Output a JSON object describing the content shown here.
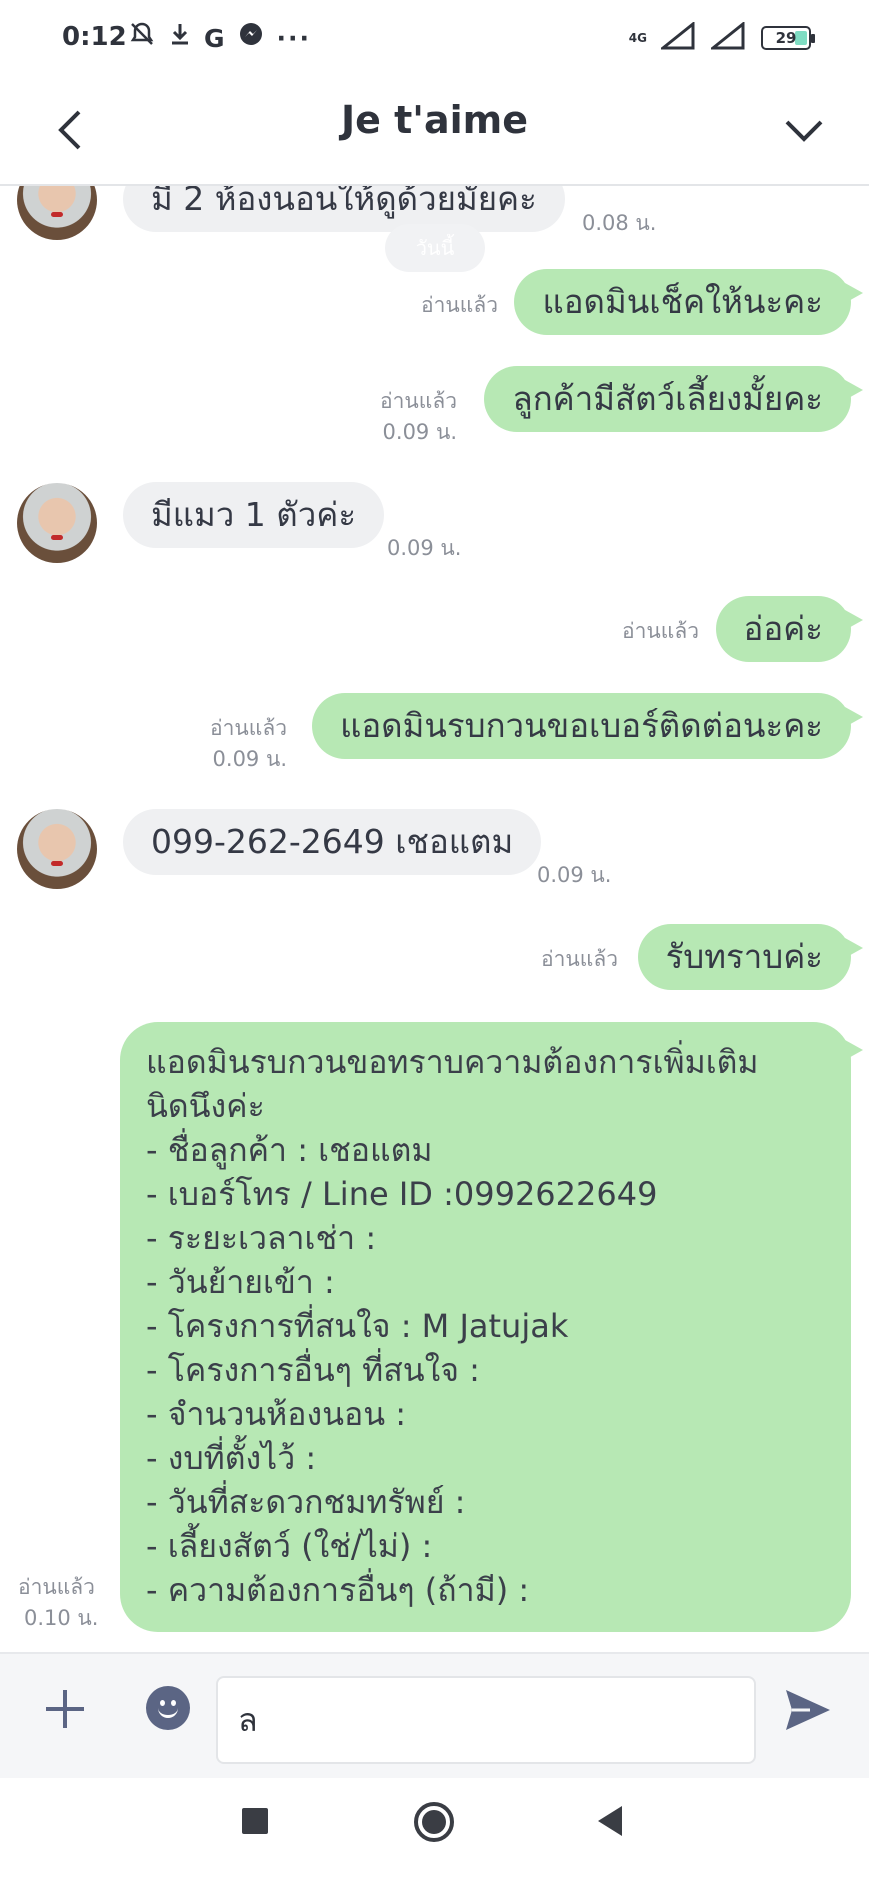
{
  "status_bar": {
    "time": "0:12",
    "left_icons": [
      "mute-icon",
      "download-icon",
      "google-icon",
      "messenger-icon",
      "more-icon"
    ],
    "network": "4G",
    "battery": "29"
  },
  "header": {
    "title": "Je t'aime",
    "back_icon": "chevron-left-icon",
    "menu_icon": "chevron-down-icon"
  },
  "messages": {
    "m0": {
      "text": "มี 2 ห้องนอนให้ดูด้วยมั้ยคะ",
      "time": "0.08 น."
    },
    "date_chip": "วันนี้",
    "m1": {
      "text": "แอดมินเช็คให้นะคะ",
      "read": "อ่านแล้ว"
    },
    "m2": {
      "text": "ลูกค้ามีสัตว์เลี้ยงมั้ยคะ",
      "read": "อ่านแล้ว",
      "time": "0.09 น."
    },
    "m3": {
      "text": "มีแมว 1 ตัวค่ะ",
      "time": "0.09 น."
    },
    "m4": {
      "text": "อ่อค่ะ",
      "read": "อ่านแล้ว"
    },
    "m5": {
      "text": "แอดมินรบกวนขอเบอร์ติดต่อนะคะ",
      "read": "อ่านแล้ว",
      "time": "0.09 น."
    },
    "m6": {
      "text": "099-262-2649 เชอแตม",
      "time": "0.09 น."
    },
    "m7": {
      "text": "รับทราบค่ะ",
      "read": "อ่านแล้ว"
    },
    "m8": {
      "lines": [
        "แอดมินรบกวนขอทราบความต้องการเพิ่มเติม",
        "นิดนึงค่ะ",
        "- ชื่อลูกค้า : เชอแตม",
        "- เบอร์โทร / Line ID :0992622649",
        "- ระยะเวลาเช่า :",
        "- วันย้ายเข้า :",
        "- โครงการที่สนใจ : M Jatujak",
        "- โครงการอื่นๆ ที่สนใจ :",
        "- จำนวนห้องนอน :",
        "- งบที่ตั้งไว้ :",
        "- วันที่สะดวกชมทรัพย์ :",
        "- เลี้ยงสัตว์ (ใช่/ไม่) :",
        "- ความต้องการอื่นๆ (ถ้ามี) :"
      ],
      "read": "อ่านแล้ว",
      "time": "0.10 น."
    }
  },
  "input_bar": {
    "value": "ล",
    "plus_icon": "plus-icon",
    "emoji_icon": "emoji-icon",
    "send_icon": "send-icon"
  },
  "colors": {
    "outgoing_bubble": "#b7e8b4",
    "incoming_bubble": "#eff0f2",
    "meta_text": "#8b8f98"
  }
}
